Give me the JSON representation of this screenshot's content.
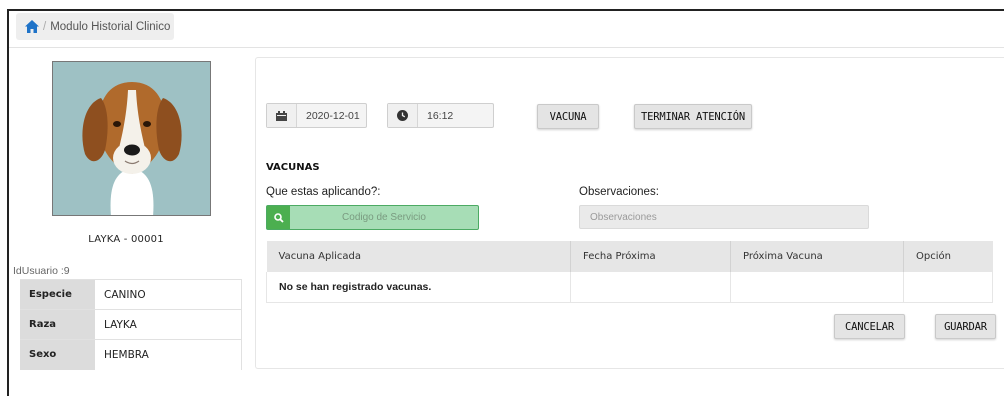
{
  "breadcrumb": {
    "icon": "home-icon",
    "separator": "/",
    "label": "Modulo Historial Clinico"
  },
  "patient": {
    "name": "LAYKA - 00001",
    "id_user": "IdUsuario :9",
    "fields": [
      {
        "key": "Especie",
        "value": "CANINO"
      },
      {
        "key": "Raza",
        "value": "LAYKA"
      },
      {
        "key": "Sexo",
        "value": "HEMBRA"
      }
    ]
  },
  "toolbar": {
    "date": "2020-12-01",
    "time": "16:12",
    "vacuna_button": "VACUNA",
    "terminar_button": "TERMINAR ATENCIÓN"
  },
  "vacunas": {
    "title": "VACUNAS",
    "service_label": "Que estas aplicando?:",
    "service_placeholder": "Codigo de Servicio",
    "observ_label": "Observaciones:",
    "observ_placeholder": "Observaciones",
    "columns": [
      "Vacuna Aplicada",
      "Fecha Próxima",
      "Próxima Vacuna",
      "Opción"
    ],
    "empty_message": "No se han registrado vacunas."
  },
  "actions": {
    "cancel": "CANCELAR",
    "save": "GUARDAR"
  },
  "colors": {
    "success": "#4caf50",
    "success_light": "#a7ddb6",
    "button_bg": "#e4e4e4",
    "photo_bg": "#9ec1c4"
  }
}
